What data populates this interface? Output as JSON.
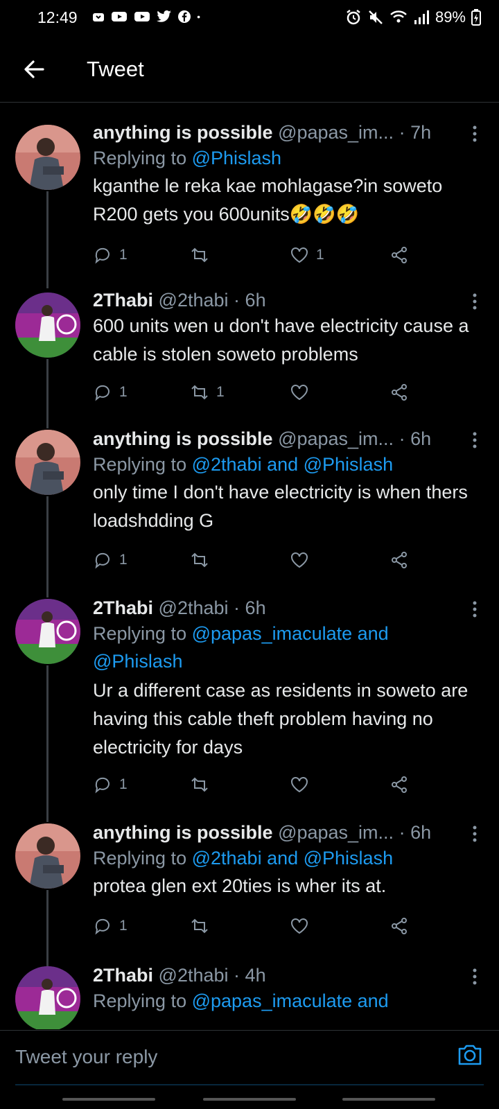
{
  "status": {
    "time": "12:49",
    "battery": "89%",
    "left_icons": [
      "notification-icon",
      "youtube-icon",
      "youtube-icon",
      "twitter-icon",
      "facebook-icon",
      "dot-icon"
    ],
    "right_icons": [
      "alarm-icon",
      "mute-icon",
      "wifi-icon",
      "signal-icon",
      "battery-icon"
    ]
  },
  "header": {
    "title": "Tweet"
  },
  "colors": {
    "accent": "#1d9bf0",
    "muted": "#8b98a5",
    "background": "#000000",
    "text": "#e7e9ea"
  },
  "tweets": [
    {
      "name": "anything is possible",
      "handle": "@papas_im...",
      "dot": "·",
      "time": "7h",
      "reply_prefix": "Replying to ",
      "reply_mentions": "@Phislash",
      "text": "kganthe le reka kae mohlagase?in soweto R200 gets you 600units🤣🤣🤣",
      "reply_count": "1",
      "retweet_count": "",
      "like_count": "1"
    },
    {
      "name": "2Thabi",
      "handle": "@2thabi",
      "dot": "·",
      "time": "6h",
      "reply_prefix": "",
      "reply_mentions": "",
      "text": "600 units wen u don't have electricity cause a cable is stolen soweto problems",
      "reply_count": "1",
      "retweet_count": "1",
      "like_count": ""
    },
    {
      "name": "anything is possible",
      "handle": "@papas_im...",
      "dot": "·",
      "time": "6h",
      "reply_prefix": "Replying to ",
      "reply_mentions": "@2thabi and @Phislash",
      "text": "only time I don't have electricity is when thers loadshdding G",
      "reply_count": "1",
      "retweet_count": "",
      "like_count": ""
    },
    {
      "name": "2Thabi",
      "handle": "@2thabi",
      "dot": "·",
      "time": "6h",
      "reply_prefix": "Replying to ",
      "reply_mentions": "@papas_imaculate and @Phislash",
      "text": "Ur a different case as residents in soweto are having this cable theft problem having no electricity for days",
      "reply_count": "1",
      "retweet_count": "",
      "like_count": ""
    },
    {
      "name": "anything is possible",
      "handle": "@papas_im...",
      "dot": "·",
      "time": "6h",
      "reply_prefix": "Replying to ",
      "reply_mentions": "@2thabi and @Phislash",
      "text": "protea glen ext 20ties is wher its at.",
      "reply_count": "1",
      "retweet_count": "",
      "like_count": ""
    },
    {
      "name": "2Thabi",
      "handle": "@2thabi",
      "dot": "·",
      "time": "4h",
      "reply_prefix": "Replying to ",
      "reply_mentions": "@papas_imaculate and",
      "text": "",
      "reply_count": "",
      "retweet_count": "",
      "like_count": ""
    }
  ],
  "reply_bar": {
    "placeholder": "Tweet your reply"
  }
}
